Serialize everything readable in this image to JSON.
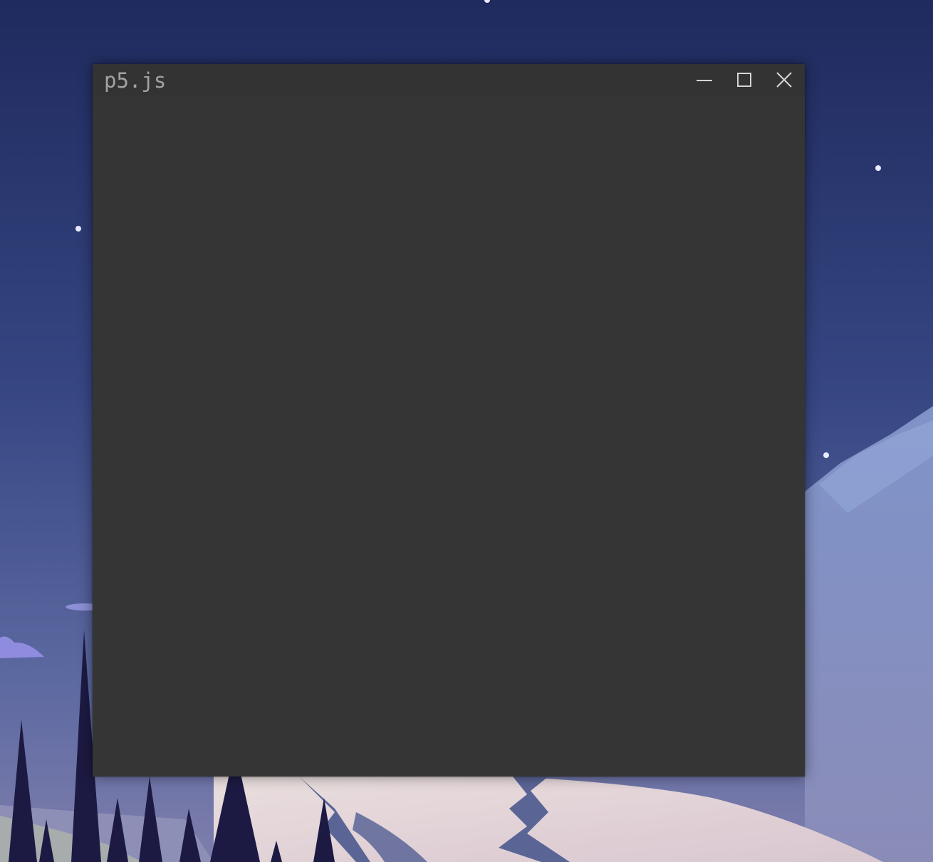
{
  "window": {
    "title": "p5.js",
    "controls": {
      "minimize_icon": "minimize-icon",
      "maximize_icon": "maximize-icon",
      "close_icon": "close-icon"
    },
    "canvas_background": "#353535"
  },
  "colors": {
    "sky_top": "#1f2a5e",
    "sky_bottom": "#6e6aa0",
    "window_bg": "#353535",
    "titlebar_bg": "#333334",
    "title_text": "#a3a3a3",
    "control_glyph": "#d6d6d6",
    "tree": "#1c1a42",
    "snow": "#e6d8d8"
  }
}
